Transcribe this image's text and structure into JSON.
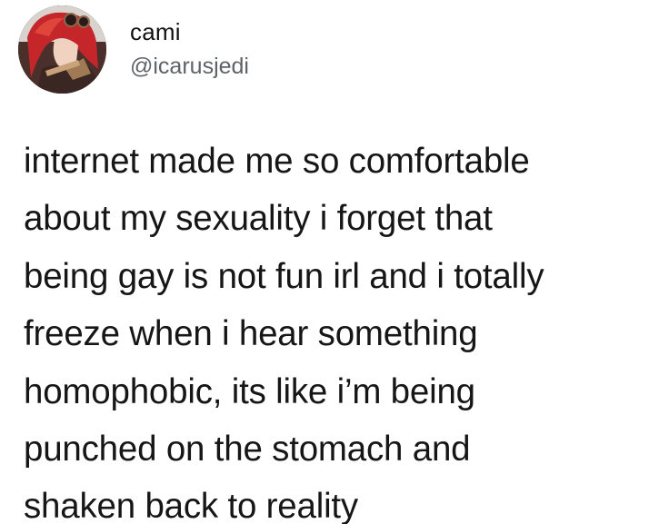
{
  "tweet": {
    "author": {
      "display_name": "cami",
      "handle": "@icarusjedi",
      "avatar_icon": "profile-avatar-red-haired-character"
    },
    "text_lines": [
      "internet made me so comfortable",
      "about my sexuality i forget that",
      "being gay is not fun irl and i totally",
      "freeze when i hear something",
      "homophobic, its like i’m being",
      "punched on the stomach and",
      "shaken back to reality"
    ]
  },
  "colors": {
    "background": "#ffffff",
    "text_primary": "#161616",
    "text_secondary": "#5f6368"
  }
}
